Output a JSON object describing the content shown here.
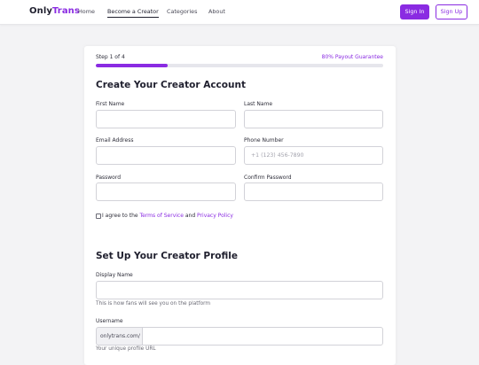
{
  "brand": {
    "part1": "Only",
    "part2": "Trans"
  },
  "nav": {
    "links": [
      "Home",
      "Become a Creator",
      "Categories",
      "About"
    ],
    "signin": "Sign In",
    "signup": "Sign Up"
  },
  "progress": {
    "step_text": "Step 1 of 4",
    "guarantee": "80% Payout Guarantee",
    "fraction": 0.25
  },
  "account": {
    "title": "Create Your Creator Account",
    "first_name_label": "First Name",
    "last_name_label": "Last Name",
    "email_label": "Email Address",
    "phone_label": "Phone Number",
    "phone_placeholder": "+1 (123) 456-7890",
    "password_label": "Password",
    "confirm_password_label": "Confirm Password",
    "terms_pre": "I agree to the ",
    "terms_link": "Terms of Service",
    "terms_mid": " and ",
    "privacy_link": "Privacy Policy"
  },
  "profile": {
    "title": "Set Up Your Creator Profile",
    "display_name_label": "Display Name",
    "display_name_hint": "This is how fans will see you on the platform",
    "username_label": "Username",
    "username_prefix": "onlytrans.com/",
    "username_hint": "Your unique profile URL"
  },
  "colors": {
    "accent": "#8a2be2",
    "background": "#f3f3f5"
  }
}
